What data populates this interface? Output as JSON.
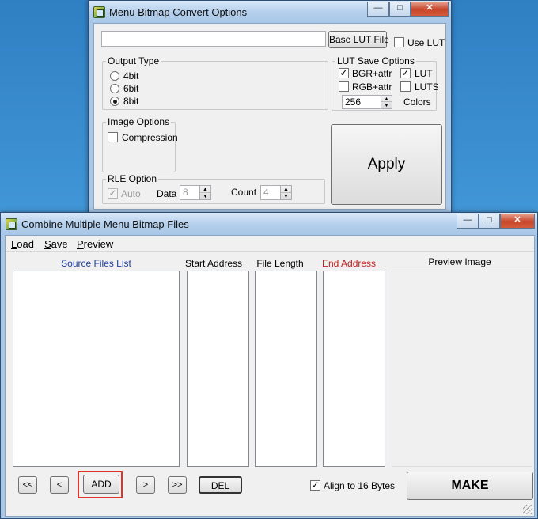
{
  "window1": {
    "title": "Menu Bitmap Convert Options",
    "controls": {
      "minimize": "—",
      "maximize": "□",
      "close": "✕"
    },
    "file_path": "",
    "base_lut_button": "Base LUT File",
    "use_lut_label": "Use LUT",
    "use_lut_checked": false,
    "output_type": {
      "legend": "Output Type",
      "options": [
        "4bit",
        "6bit",
        "8bit"
      ],
      "selected": "8bit"
    },
    "lut_save": {
      "legend": "LUT Save Options",
      "bgr_label": "BGR+attr",
      "bgr_checked": true,
      "lut_label": "LUT",
      "lut_checked": true,
      "rgb_label": "RGB+attr",
      "rgb_checked": false,
      "luts_label": "LUTS",
      "luts_checked": false,
      "colors_value": "256",
      "colors_label": "Colors"
    },
    "image_options": {
      "legend": "Image Options",
      "compression_label": "Compression",
      "compression_checked": false
    },
    "rle": {
      "legend": "RLE  Option",
      "auto_label": "Auto",
      "auto_checked": true,
      "data_label": "Data",
      "data_value": "8",
      "count_label": "Count",
      "count_value": "4"
    },
    "apply_button": "Apply"
  },
  "window2": {
    "title": "Combine Multiple Menu Bitmap Files",
    "controls": {
      "minimize": "—",
      "maximize": "□",
      "close": "✕"
    },
    "menu": [
      "Load",
      "Save",
      "Preview"
    ],
    "columns": {
      "source": "Source Files List",
      "start": "Start Address",
      "length": "File Length",
      "end": "End Address",
      "preview": "Preview Image"
    },
    "buttons": {
      "first": "<<",
      "prev": "<",
      "add": "ADD",
      "next": ">",
      "last": ">>",
      "del": "DEL",
      "make": "MAKE"
    },
    "align_label": "Align to 16 Bytes",
    "align_checked": true
  },
  "colors": {
    "source_header": "#1f3f9f",
    "end_header": "#c0201c",
    "highlight": "#e0312b"
  }
}
